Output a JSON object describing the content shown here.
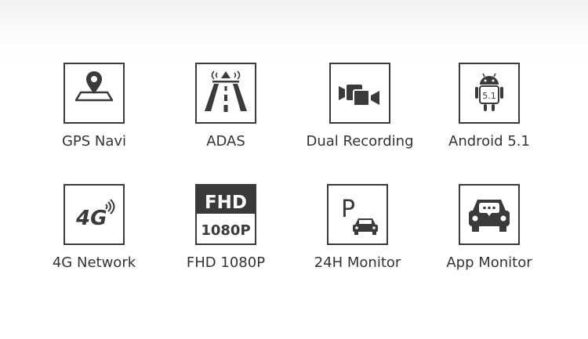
{
  "features": [
    {
      "label": "GPS Navi",
      "icon": "gps-map-pin-icon"
    },
    {
      "label": "ADAS",
      "icon": "adas-road-icon"
    },
    {
      "label": "Dual Recording",
      "icon": "dual-camera-icon"
    },
    {
      "label": "Android 5.1",
      "icon": "android-robot-icon",
      "icon_text": "5.1"
    },
    {
      "label": "4G Network",
      "icon": "4g-signal-icon",
      "icon_text": "4G"
    },
    {
      "label": "FHD 1080P",
      "icon": "fhd-badge-icon",
      "icon_text_top": "FHD",
      "icon_text_bottom": "1080P"
    },
    {
      "label": "24H Monitor",
      "icon": "parking-car-icon",
      "icon_text": "P"
    },
    {
      "label": "App Monitor",
      "icon": "car-chat-icon"
    }
  ],
  "colors": {
    "icon": "#3a3a3a",
    "text": "#333333",
    "background": "#ffffff"
  }
}
